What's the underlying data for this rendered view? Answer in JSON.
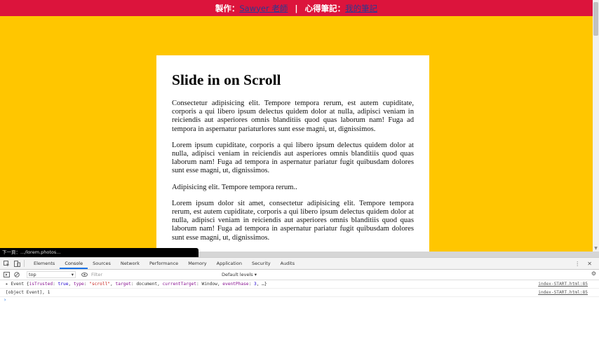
{
  "topbar": {
    "maker_label": "製作：",
    "maker_link": "Sawyer 老師",
    "separator": "|",
    "notes_label": "心得筆記：",
    "notes_link": "我的筆記"
  },
  "card": {
    "title": "Slide in on Scroll",
    "paragraphs": [
      "Consectetur adipisicing elit. Tempore tempora rerum, est autem cupiditate, corporis a qui libero ipsum delectus quidem dolor at nulla, adipisci veniam in reiciendis aut asperiores omnis blanditiis quod quas laborum nam! Fuga ad tempora in aspernatur pariaturlores sunt esse magni, ut, dignissimos.",
      "Lorem ipsum cupiditate, corporis a qui libero ipsum delectus quidem dolor at nulla, adipisci veniam in reiciendis aut asperiores omnis blanditiis quod quas laborum nam! Fuga ad tempora in aspernatur pariatur fugit quibusdam dolores sunt esse magni, ut, dignissimos.",
      "Adipisicing elit. Tempore tempora rerum..",
      "Lorem ipsum dolor sit amet, consectetur adipisicing elit. Tempore tempora rerum, est autem cupiditate, corporis a qui libero ipsum delectus quidem dolor at nulla, adipisci veniam in reiciendis aut asperiores omnis blanditiis quod quas laborum nam! Fuga ad tempora in aspernatur pariatur fugit quibusdam dolores sunt esse magni, ut, dignissimos."
    ]
  },
  "status_url": "下一頁：.../lorem.photos...",
  "devtools": {
    "tabs": [
      "Elements",
      "Console",
      "Sources",
      "Network",
      "Performance",
      "Memory",
      "Application",
      "Security",
      "Audits"
    ],
    "active_tab": "Console",
    "context": "top",
    "filter_placeholder": "Filter",
    "levels": "Default levels ▾",
    "logs": [
      {
        "msg_prefix": "▸ Event {",
        "k1": "isTrusted",
        "v1": "true",
        "k2": "type",
        "v2": "\"scroll\"",
        "k3": "target",
        "v3": "document",
        "k4": "currentTarget",
        "v4": "Window",
        "k5": "eventPhase",
        "v5": "3",
        "msg_suffix": ", …}",
        "src": "index-START.html:85"
      },
      {
        "msg": "[object Event], 1",
        "src": "index-START.html:85"
      }
    ],
    "prompt": "›"
  },
  "icons": {
    "inspect": "inspect-icon",
    "device": "device-toggle-icon",
    "clear": "clear-console-icon",
    "eye": "eye-icon",
    "more": "more-vertical-icon",
    "close": "close-icon",
    "gear": "gear-icon"
  },
  "colors": {
    "topbar": "#dc143c",
    "background": "#ffc600",
    "card": "#ffffff",
    "link": "#2b3a8f",
    "active_tab": "#1a73e8"
  }
}
